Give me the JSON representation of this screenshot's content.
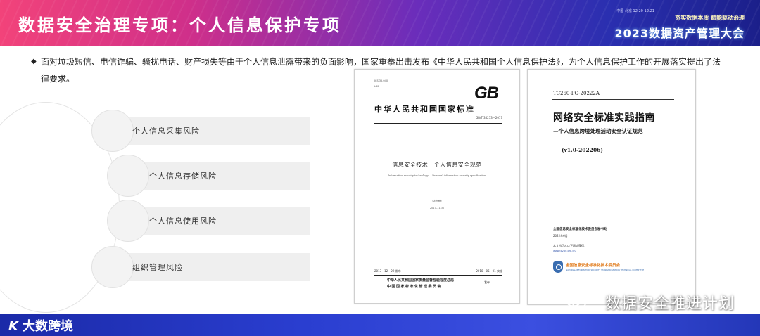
{
  "header": {
    "title": "数据安全治理专项：个人信息保护专项",
    "conference_meta": "中国 北京 12.20-12.21",
    "conference_tagline": "夯实数据本质 赋能驱动治理",
    "conference_name": "2023数据资产管理大会"
  },
  "intro": {
    "bullet": "◆",
    "text": "面对垃圾短信、电信诈骗、骚扰电话、财产损失等由于个人信息泄露带来的负面影响，国家重拳出击发布《中华人民共和国个人信息保护法》，为个人信息保护工作的开展落实提出了法律要求。"
  },
  "risks": [
    {
      "label": "个人信息采集风险"
    },
    {
      "label": "个人信息存储风险"
    },
    {
      "label": "个人信息使用风险"
    },
    {
      "label": "组织管理风险"
    }
  ],
  "doc_gb": {
    "ics": "ICS 35.040",
    "class": "L80",
    "logo": "GB",
    "national_standard": "中华人民共和国国家标准",
    "standard_no": "GB/T 35273—2017",
    "title_cn": "信息安全技术　个人信息安全规范",
    "title_en": "Information security technology — Personal information security specification",
    "draft": "（发布稿）",
    "draft_date": "2017-11-30",
    "published": "2017－12－29 发布",
    "implemented": "2018－05－01 实施",
    "issuer_line1": "中华人民共和国国家质量监督检验检疫总局",
    "issuer_line2": "中国国家标准化管理委员会",
    "issued": "发布"
  },
  "doc_tc260": {
    "code": "TC260-PG-20222A",
    "title": "网络安全标准实践指南",
    "subtitle": "—个人信息跨境处理活动安全认证规范",
    "version": "(v1.0-202206)",
    "org": "全国信息安全标准化技术委员会秘书处",
    "date": "2022年6月",
    "download": "本文档可从以下网址获得：",
    "url": "www.tc260.org.cn/",
    "committee_cn": "全国信息安全标准化技术委员会",
    "committee_en": "NATIONAL INFORMATION SECURITY STANDARDIZATION TECHNICAL COMMITTEE"
  },
  "watermark": "数据安全推进计划",
  "footer": {
    "logo_mark": "K",
    "logo_text": "大数跨境"
  }
}
